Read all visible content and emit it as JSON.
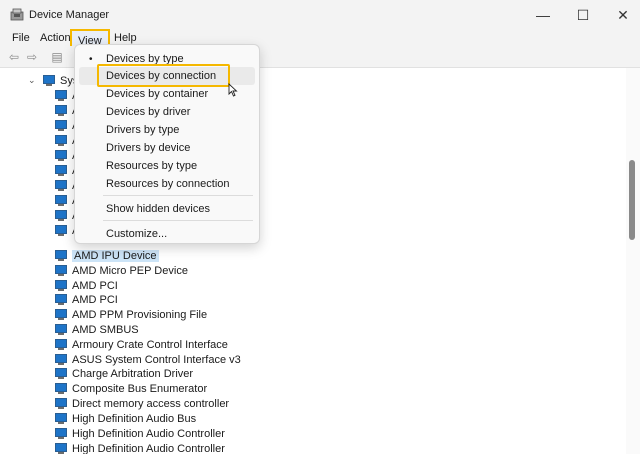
{
  "window": {
    "title": "Device Manager",
    "controls": {
      "minimize": "—",
      "maximize": "☐",
      "close": "✕"
    }
  },
  "menubar": {
    "items": [
      {
        "label": "File"
      },
      {
        "label": "Action"
      },
      {
        "label": "View"
      },
      {
        "label": "Help"
      }
    ]
  },
  "toolbar": {
    "back_glyph": "⇦",
    "forward_glyph": "⇨",
    "properties_glyph": "▤"
  },
  "view_menu": {
    "items": [
      {
        "label": "Devices by type",
        "checked": true,
        "bullet": "•"
      },
      {
        "label": "Devices by connection",
        "hovered": true
      },
      {
        "label": "Devices by container"
      },
      {
        "label": "Devices by driver"
      },
      {
        "label": "Drivers by type"
      },
      {
        "label": "Drivers by device"
      },
      {
        "label": "Resources by type"
      },
      {
        "label": "Resources by connection"
      },
      {
        "label": "Show hidden devices"
      },
      {
        "label": "Customize..."
      }
    ]
  },
  "tree": {
    "root": {
      "label": "Syst",
      "expander": "⌄"
    },
    "items": [
      {
        "label": "A"
      },
      {
        "label": "A"
      },
      {
        "label": "A"
      },
      {
        "label": "A"
      },
      {
        "label": "A"
      },
      {
        "label": "A"
      },
      {
        "label": "A"
      },
      {
        "label": "A"
      },
      {
        "label": "A"
      },
      {
        "label": "A"
      },
      {
        "label": "AMD IPU Device",
        "selected": true
      },
      {
        "label": "AMD Micro PEP Device"
      },
      {
        "label": "AMD PCI"
      },
      {
        "label": "AMD PCI"
      },
      {
        "label": "AMD PPM Provisioning File"
      },
      {
        "label": "AMD SMBUS"
      },
      {
        "label": "Armoury Crate Control Interface"
      },
      {
        "label": "ASUS System Control Interface v3"
      },
      {
        "label": "Charge Arbitration Driver"
      },
      {
        "label": "Composite Bus Enumerator"
      },
      {
        "label": "Direct memory access controller"
      },
      {
        "label": "High Definition Audio Bus"
      },
      {
        "label": "High Definition Audio Controller"
      },
      {
        "label": "High Definition Audio Controller"
      }
    ]
  },
  "colors": {
    "accent_highlight": "#f5b800",
    "selection": "#cce4f7",
    "device_icon": "#1e74c8"
  }
}
